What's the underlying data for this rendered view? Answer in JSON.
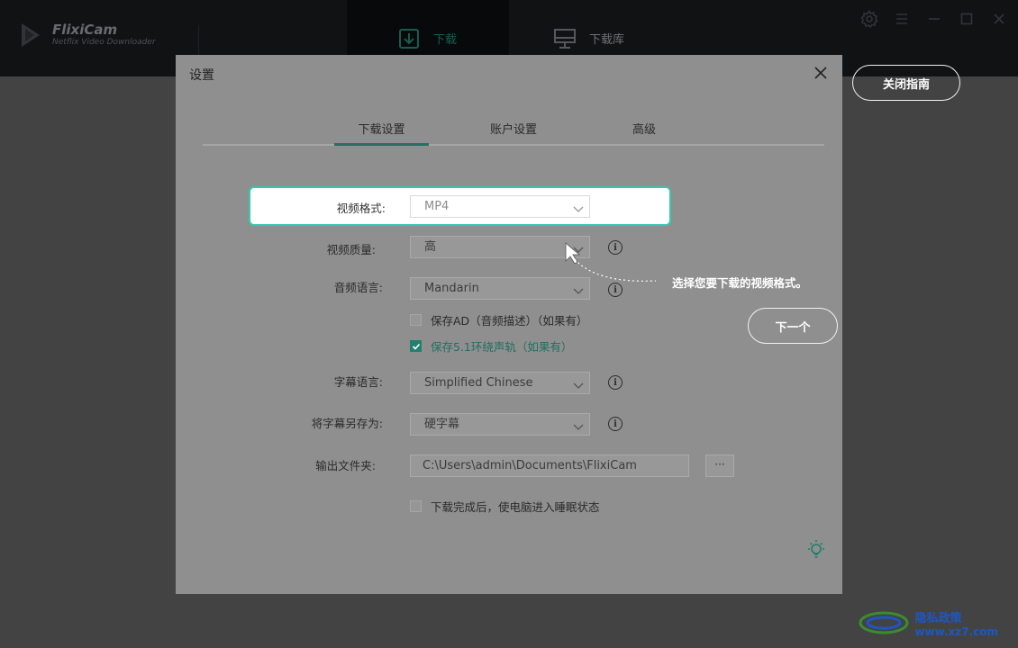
{
  "app": {
    "name": "FlixiCam",
    "subtitle": "Netflix Video Downloader",
    "nav": [
      {
        "label": "下载",
        "active": true
      },
      {
        "label": "下载库",
        "active": false
      }
    ]
  },
  "dialog": {
    "title": "设置",
    "tabs": [
      {
        "label": "下载设置",
        "active": true
      },
      {
        "label": "账户设置",
        "active": false
      },
      {
        "label": "高级",
        "active": false
      }
    ],
    "fields": {
      "video_format": {
        "label": "视频格式:",
        "value": "MP4"
      },
      "video_quality": {
        "label": "视频质量:",
        "value": "高"
      },
      "audio_language": {
        "label": "音频语言:",
        "value": "Mandarin"
      },
      "subtitle_language": {
        "label": "字幕语言:",
        "value": "Simplified Chinese"
      },
      "save_subtitle_as": {
        "label": "将字幕另存为:",
        "value": "硬字幕"
      },
      "output_folder": {
        "label": "输出文件夹:",
        "value": "C:\\Users\\admin\\Documents\\FlixiCam",
        "browse": "···"
      }
    },
    "checkboxes": {
      "save_ad": {
        "label": "保存AD（音频描述）（如果有）",
        "checked": false
      },
      "save_51": {
        "label": "保存5.1环绕声轨（如果有）",
        "checked": true
      },
      "sleep_after": {
        "label": "下载完成后，使电脑进入睡眠状态",
        "checked": false
      }
    }
  },
  "guide": {
    "close_label": "关闭指南",
    "tip": "选择您要下载的视频格式。",
    "next_label": "下一个"
  },
  "footer": {
    "privacy": "隐私政策",
    "watermark_site": "www.xz7.com"
  },
  "colors": {
    "accent": "#35c9ae",
    "checkbox_on": "#23806e",
    "topbar": "#1f2126"
  }
}
